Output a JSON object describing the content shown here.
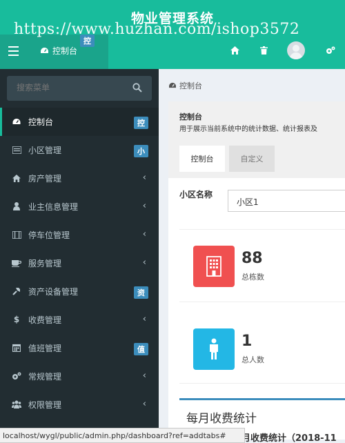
{
  "header": {
    "site_title": "物业管理系统",
    "watermark": "https://www.huzhan.com/ishop3572",
    "tab_label": "控制台",
    "tab_badge": "控"
  },
  "sidebar": {
    "search_placeholder": "搜索菜单",
    "items": [
      {
        "label": "控制台",
        "icon": "dashboard-icon",
        "badge": "控",
        "active": true
      },
      {
        "label": "小区管理",
        "icon": "list-icon",
        "badge": "小"
      },
      {
        "label": "房产管理",
        "icon": "home-icon",
        "arrow": "‹"
      },
      {
        "label": "业主信息管理",
        "icon": "user-icon",
        "arrow": "‹"
      },
      {
        "label": "停车位管理",
        "icon": "film-icon",
        "arrow": "‹"
      },
      {
        "label": "服务管理",
        "icon": "coffee-icon",
        "arrow": "‹"
      },
      {
        "label": "资产设备管理",
        "icon": "wrench-icon",
        "badge": "资"
      },
      {
        "label": "收费管理",
        "icon": "dollar-icon",
        "arrow": "‹"
      },
      {
        "label": "值班管理",
        "icon": "calendar-icon",
        "badge": "值"
      },
      {
        "label": "常规管理",
        "icon": "cogs-icon",
        "arrow": "‹"
      },
      {
        "label": "权限管理",
        "icon": "group-icon",
        "arrow": "‹"
      }
    ]
  },
  "content": {
    "breadcrumb": "控制台",
    "panel_title": "控制台",
    "panel_desc": "用于展示当前系统中的统计数据、统计报表及",
    "tabs": [
      "控制台",
      "自定义"
    ],
    "community_label": "小区名称",
    "community_value": "小区1",
    "stats": [
      {
        "value": "88",
        "label": "总栋数",
        "icon": "building-icon",
        "color": "#f05050"
      },
      {
        "value": "1",
        "label": "总人数",
        "icon": "person-icon",
        "color": "#23b7e5"
      }
    ],
    "monthly_title": "每月收费统计",
    "behind_text": "月收费统计（2018-11"
  },
  "statusbar": {
    "url": "localhost/wygl/public/admin.php/dashboard?ref=addtabs#"
  },
  "colors": {
    "header": "#18bc9c",
    "sidebar": "#222d32",
    "badge": "#3c8dbc"
  }
}
